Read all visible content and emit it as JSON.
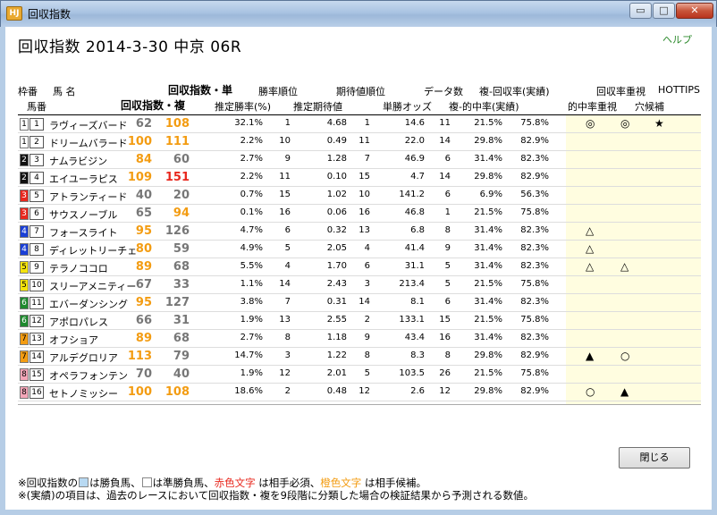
{
  "window": {
    "icon_text": "HJ",
    "title": "回収指数",
    "minimize": "▭",
    "maximize": "□",
    "close": "✕"
  },
  "help": "ヘルプ",
  "page_title": "回収指数  2014-3-30 中京 06R",
  "headers": {
    "waku": "枠番",
    "uma": "馬 名",
    "umaban": "馬番",
    "kaishu_tan": "回収指数・単",
    "kaishu_fuku": "回収指数・複",
    "shoritsu_rank": "勝率順位",
    "suitei_shoritsu": "推定勝率(%)",
    "kitaichi_rank": "期待値順位",
    "suitei_kitaichi": "推定期待値",
    "data_count": "データ数",
    "tansho_odds": "単勝オッズ",
    "fuku_kaishu": "複-回収率(実績)",
    "fuku_tekichu": "複-的中率(実績)",
    "kaishu_juushi": "回収率重視",
    "tekichu_juushi": "的中率重視",
    "hottips": "HOTTIPS",
    "ana_kouho": "穴候補"
  },
  "colors": {
    "red": "#e8281e",
    "orange": "#f39c12",
    "gray": "#777777",
    "blue_box": "#b8d9f2",
    "panel": "#fffde0"
  },
  "rows": [
    {
      "waku": "1",
      "wcolor": "#ffffff",
      "wtext": "#000",
      "ban": "1",
      "name": "ラヴィーズバード",
      "tan": "62",
      "tanc": "#777777",
      "fuku": "108",
      "fukuc": "#f39c12",
      "shoritsu": "32.1%",
      "srank": "1",
      "kitaichi": "4.68",
      "krank": "1",
      "odds": "14.6",
      "count": "11",
      "kaishu": "21.5%",
      "tekichu": "75.8%",
      "m1": "◎",
      "m2": "◎",
      "m3": "★"
    },
    {
      "waku": "1",
      "wcolor": "#ffffff",
      "wtext": "#000",
      "ban": "2",
      "name": "ドリームバラード",
      "tan": "100",
      "tanc": "#f39c12",
      "fuku": "111",
      "fukuc": "#f39c12",
      "shoritsu": "2.2%",
      "srank": "10",
      "kitaichi": "0.49",
      "krank": "11",
      "odds": "22.0",
      "count": "14",
      "kaishu": "29.8%",
      "tekichu": "82.9%",
      "m1": "",
      "m2": "",
      "m3": ""
    },
    {
      "waku": "2",
      "wcolor": "#111111",
      "wtext": "#fff",
      "ban": "3",
      "name": "ナムラビジン",
      "tan": "84",
      "tanc": "#f39c12",
      "fuku": "60",
      "fukuc": "#777777",
      "shoritsu": "2.7%",
      "srank": "9",
      "kitaichi": "1.28",
      "krank": "7",
      "odds": "46.9",
      "count": "6",
      "kaishu": "31.4%",
      "tekichu": "82.3%",
      "m1": "",
      "m2": "",
      "m3": ""
    },
    {
      "waku": "2",
      "wcolor": "#111111",
      "wtext": "#fff",
      "ban": "4",
      "name": "エイユーラピス",
      "tan": "109",
      "tanc": "#f39c12",
      "fuku": "151",
      "fukuc": "#e8281e",
      "shoritsu": "2.2%",
      "srank": "11",
      "kitaichi": "0.10",
      "krank": "15",
      "odds": "4.7",
      "count": "14",
      "kaishu": "29.8%",
      "tekichu": "82.9%",
      "m1": "",
      "m2": "",
      "m3": ""
    },
    {
      "waku": "3",
      "wcolor": "#e8281e",
      "wtext": "#fff",
      "ban": "5",
      "name": "アトランティード",
      "tan": "40",
      "tanc": "#777777",
      "fuku": "20",
      "fukuc": "#777777",
      "shoritsu": "0.7%",
      "srank": "15",
      "kitaichi": "1.02",
      "krank": "10",
      "odds": "141.2",
      "count": "6",
      "kaishu": "6.9%",
      "tekichu": "56.3%",
      "m1": "",
      "m2": "",
      "m3": ""
    },
    {
      "waku": "3",
      "wcolor": "#e8281e",
      "wtext": "#fff",
      "ban": "6",
      "name": "サウスノーブル",
      "tan": "65",
      "tanc": "#777777",
      "fuku": "94",
      "fukuc": "#f39c12",
      "shoritsu": "0.1%",
      "srank": "16",
      "kitaichi": "0.06",
      "krank": "16",
      "odds": "46.8",
      "count": "1",
      "kaishu": "21.5%",
      "tekichu": "75.8%",
      "m1": "",
      "m2": "",
      "m3": ""
    },
    {
      "waku": "4",
      "wcolor": "#1a3fd6",
      "wtext": "#fff",
      "ban": "7",
      "name": "フォースライト",
      "tan": "95",
      "tanc": "#f39c12",
      "fuku": "126",
      "fukuc": "#777777",
      "shoritsu": "4.7%",
      "srank": "6",
      "kitaichi": "0.32",
      "krank": "13",
      "odds": "6.8",
      "count": "8",
      "kaishu": "31.4%",
      "tekichu": "82.3%",
      "m1": "△",
      "m2": "",
      "m3": ""
    },
    {
      "waku": "4",
      "wcolor": "#1a3fd6",
      "wtext": "#fff",
      "ban": "8",
      "name": "ディレットリーチェ",
      "tan": "80",
      "tanc": "#f39c12",
      "fuku": "59",
      "fukuc": "#777777",
      "shoritsu": "4.9%",
      "srank": "5",
      "kitaichi": "2.05",
      "krank": "4",
      "odds": "41.4",
      "count": "9",
      "kaishu": "31.4%",
      "tekichu": "82.3%",
      "m1": "△",
      "m2": "",
      "m3": ""
    },
    {
      "waku": "5",
      "wcolor": "#f4e30c",
      "wtext": "#000",
      "ban": "9",
      "name": "テラノココロ",
      "tan": "89",
      "tanc": "#f39c12",
      "fuku": "68",
      "fukuc": "#777777",
      "shoritsu": "5.5%",
      "srank": "4",
      "kitaichi": "1.70",
      "krank": "6",
      "odds": "31.1",
      "count": "5",
      "kaishu": "31.4%",
      "tekichu": "82.3%",
      "m1": "△",
      "m2": "△",
      "m3": ""
    },
    {
      "waku": "5",
      "wcolor": "#f4e30c",
      "wtext": "#000",
      "ban": "10",
      "name": "スリーアメニティー",
      "tan": "67",
      "tanc": "#777777",
      "fuku": "33",
      "fukuc": "#777777",
      "shoritsu": "1.1%",
      "srank": "14",
      "kitaichi": "2.43",
      "krank": "3",
      "odds": "213.4",
      "count": "5",
      "kaishu": "21.5%",
      "tekichu": "75.8%",
      "m1": "",
      "m2": "",
      "m3": ""
    },
    {
      "waku": "6",
      "wcolor": "#1e8a2e",
      "wtext": "#fff",
      "ban": "11",
      "name": "エバーダンシング",
      "tan": "95",
      "tanc": "#f39c12",
      "fuku": "127",
      "fukuc": "#777777",
      "shoritsu": "3.8%",
      "srank": "7",
      "kitaichi": "0.31",
      "krank": "14",
      "odds": "8.1",
      "count": "6",
      "kaishu": "31.4%",
      "tekichu": "82.3%",
      "m1": "",
      "m2": "",
      "m3": ""
    },
    {
      "waku": "6",
      "wcolor": "#1e8a2e",
      "wtext": "#fff",
      "ban": "12",
      "name": "アポロパレス",
      "tan": "66",
      "tanc": "#777777",
      "fuku": "31",
      "fukuc": "#777777",
      "shoritsu": "1.9%",
      "srank": "13",
      "kitaichi": "2.55",
      "krank": "2",
      "odds": "133.1",
      "count": "15",
      "kaishu": "21.5%",
      "tekichu": "75.8%",
      "m1": "",
      "m2": "",
      "m3": ""
    },
    {
      "waku": "7",
      "wcolor": "#f39c12",
      "wtext": "#000",
      "ban": "13",
      "name": "オフショア",
      "tan": "89",
      "tanc": "#f39c12",
      "fuku": "68",
      "fukuc": "#777777",
      "shoritsu": "2.7%",
      "srank": "8",
      "kitaichi": "1.18",
      "krank": "9",
      "odds": "43.4",
      "count": "16",
      "kaishu": "31.4%",
      "tekichu": "82.3%",
      "m1": "",
      "m2": "",
      "m3": ""
    },
    {
      "waku": "7",
      "wcolor": "#f39c12",
      "wtext": "#000",
      "ban": "14",
      "name": "アルデグロリア",
      "tan": "113",
      "tanc": "#f39c12",
      "fuku": "79",
      "fukuc": "#777777",
      "shoritsu": "14.7%",
      "srank": "3",
      "kitaichi": "1.22",
      "krank": "8",
      "odds": "8.3",
      "count": "8",
      "kaishu": "29.8%",
      "tekichu": "82.9%",
      "m1": "▲",
      "m2": "○",
      "m3": ""
    },
    {
      "waku": "8",
      "wcolor": "#f4a6b8",
      "wtext": "#000",
      "ban": "15",
      "name": "オペラフォンテン",
      "tan": "70",
      "tanc": "#777777",
      "fuku": "40",
      "fukuc": "#777777",
      "shoritsu": "1.9%",
      "srank": "12",
      "kitaichi": "2.01",
      "krank": "5",
      "odds": "103.5",
      "count": "26",
      "kaishu": "21.5%",
      "tekichu": "75.8%",
      "m1": "",
      "m2": "",
      "m3": ""
    },
    {
      "waku": "8",
      "wcolor": "#f4a6b8",
      "wtext": "#000",
      "ban": "16",
      "name": "セトノミッシー",
      "tan": "100",
      "tanc": "#f39c12",
      "fuku": "108",
      "fukuc": "#f39c12",
      "shoritsu": "18.6%",
      "srank": "2",
      "kitaichi": "0.48",
      "krank": "12",
      "odds": "2.6",
      "count": "12",
      "kaishu": "29.8%",
      "tekichu": "82.9%",
      "m1": "○",
      "m2": "▲",
      "m3": ""
    }
  ],
  "footer": {
    "line1_a": "※回収指数の",
    "line1_b": "は勝負馬、",
    "line1_c": "は準勝負馬、",
    "line1_red": "赤色文字",
    "line1_d": " は相手必須、",
    "line1_orange": "橙色文字",
    "line1_e": " は相手候補。",
    "line2": "※(実績)の項目は、過去のレースにおいて回収指数・複を9段階に分類した場合の検証結果から予測される数値。"
  },
  "close_button": "閉じる"
}
